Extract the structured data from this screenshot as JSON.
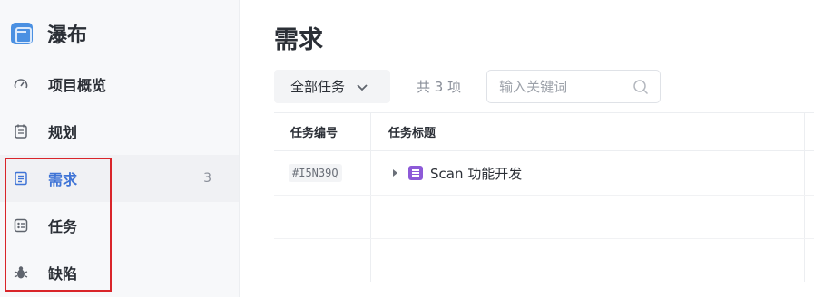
{
  "app": {
    "title": "瀑布"
  },
  "sidebar": {
    "items": [
      {
        "label": "项目概览",
        "icon": "dashboard-gauge-icon",
        "active": false
      },
      {
        "label": "规划",
        "icon": "calendar-plan-icon",
        "active": false
      },
      {
        "label": "需求",
        "icon": "document-list-icon",
        "active": true,
        "count": "3"
      },
      {
        "label": "任务",
        "icon": "checklist-icon",
        "active": false
      },
      {
        "label": "缺陷",
        "icon": "bug-icon",
        "active": false
      }
    ]
  },
  "main": {
    "title": "需求",
    "filter": {
      "label": "全部任务"
    },
    "total": "共 3 项",
    "search": {
      "placeholder": "输入关键词",
      "value": ""
    },
    "table": {
      "headers": {
        "id": "任务编号",
        "title": "任务标题"
      },
      "rows": [
        {
          "id": "#I5N39Q",
          "title": "Scan 功能开发",
          "type_color": "#8d5ad8"
        }
      ]
    }
  },
  "colors": {
    "accent": "#3f74d6",
    "highlight": "#d9252a",
    "brand": "#4a90e2"
  }
}
